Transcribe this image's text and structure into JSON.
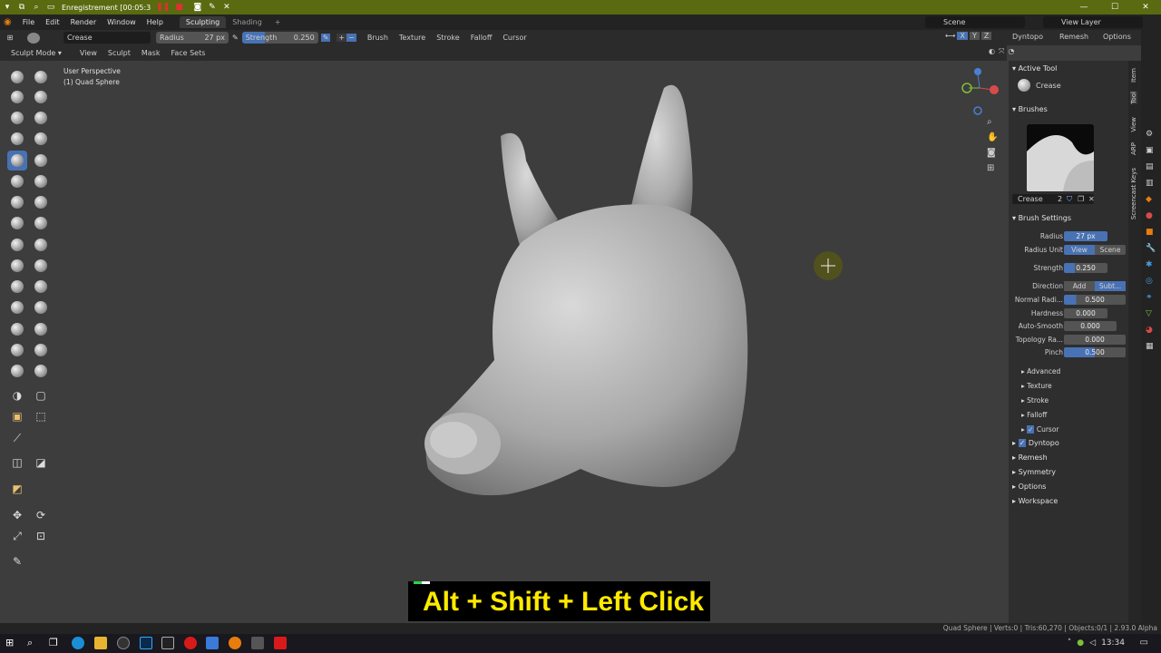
{
  "window": {
    "title": "Enregistrement [00:05:3"
  },
  "menubar": {
    "items": [
      "File",
      "Edit",
      "Render",
      "Window",
      "Help"
    ],
    "workspace_tabs": [
      "Sculpting",
      "Shading"
    ],
    "scene": "Scene",
    "view_layer": "View Layer"
  },
  "tool_header": {
    "brush_name": "Crease",
    "radius_label": "Radius",
    "radius_value": "27 px",
    "strength_label": "Strength",
    "strength_value": "0.250",
    "dropdowns": [
      "Brush",
      "Texture",
      "Stroke",
      "Falloff",
      "Cursor"
    ],
    "axes": [
      "X",
      "Y",
      "Z"
    ],
    "right_dropdowns": [
      "Dyntopo",
      "Remesh",
      "Options"
    ]
  },
  "mode_header": {
    "mode": "Sculpt Mode",
    "items": [
      "View",
      "Sculpt",
      "Mask",
      "Face Sets"
    ]
  },
  "viewport": {
    "perspective": "User Perspective",
    "object": "(1) Quad Sphere"
  },
  "sidebar": {
    "active_tool_title": "Active Tool",
    "active_tool_name": "Crease",
    "brushes_title": "Brushes",
    "brush_slot_name": "Crease",
    "brush_users": "2",
    "brush_settings_title": "Brush Settings",
    "settings": {
      "radius_label": "Radius",
      "radius_value": "27 px",
      "radius_unit_label": "Radius Unit",
      "unit_view": "View",
      "unit_scene": "Scene",
      "strength_label": "Strength",
      "strength_value": "0.250",
      "direction_label": "Direction",
      "dir_add": "Add",
      "dir_sub": "Subt...",
      "normal_radius_label": "Normal Radi...",
      "normal_radius_value": "0.500",
      "hardness_label": "Hardness",
      "hardness_value": "0.000",
      "autosmooth_label": "Auto-Smooth",
      "autosmooth_value": "0.000",
      "topology_label": "Topology Ra...",
      "topology_value": "0.000",
      "pinch_label": "Pinch",
      "pinch_value": "0.500"
    },
    "subpanels": [
      "Advanced",
      "Texture",
      "Stroke",
      "Falloff",
      "Cursor"
    ],
    "panels": [
      "Dyntopo",
      "Remesh",
      "Symmetry",
      "Options",
      "Workspace"
    ],
    "tabs": [
      "Item",
      "Tool",
      "View",
      "ARP",
      "Screencast Keys"
    ]
  },
  "caption": "Alt + Shift + Left Click",
  "status": "Quad Sphere | Verts:0 | Tris:60,270 | Objects:0/1 | 2.93.0 Alpha",
  "taskbar": {
    "time": "13:34"
  },
  "colors": {
    "accent": "#4872b4",
    "caption_text": "#ffea00",
    "titlebar": "#5a6a10"
  }
}
